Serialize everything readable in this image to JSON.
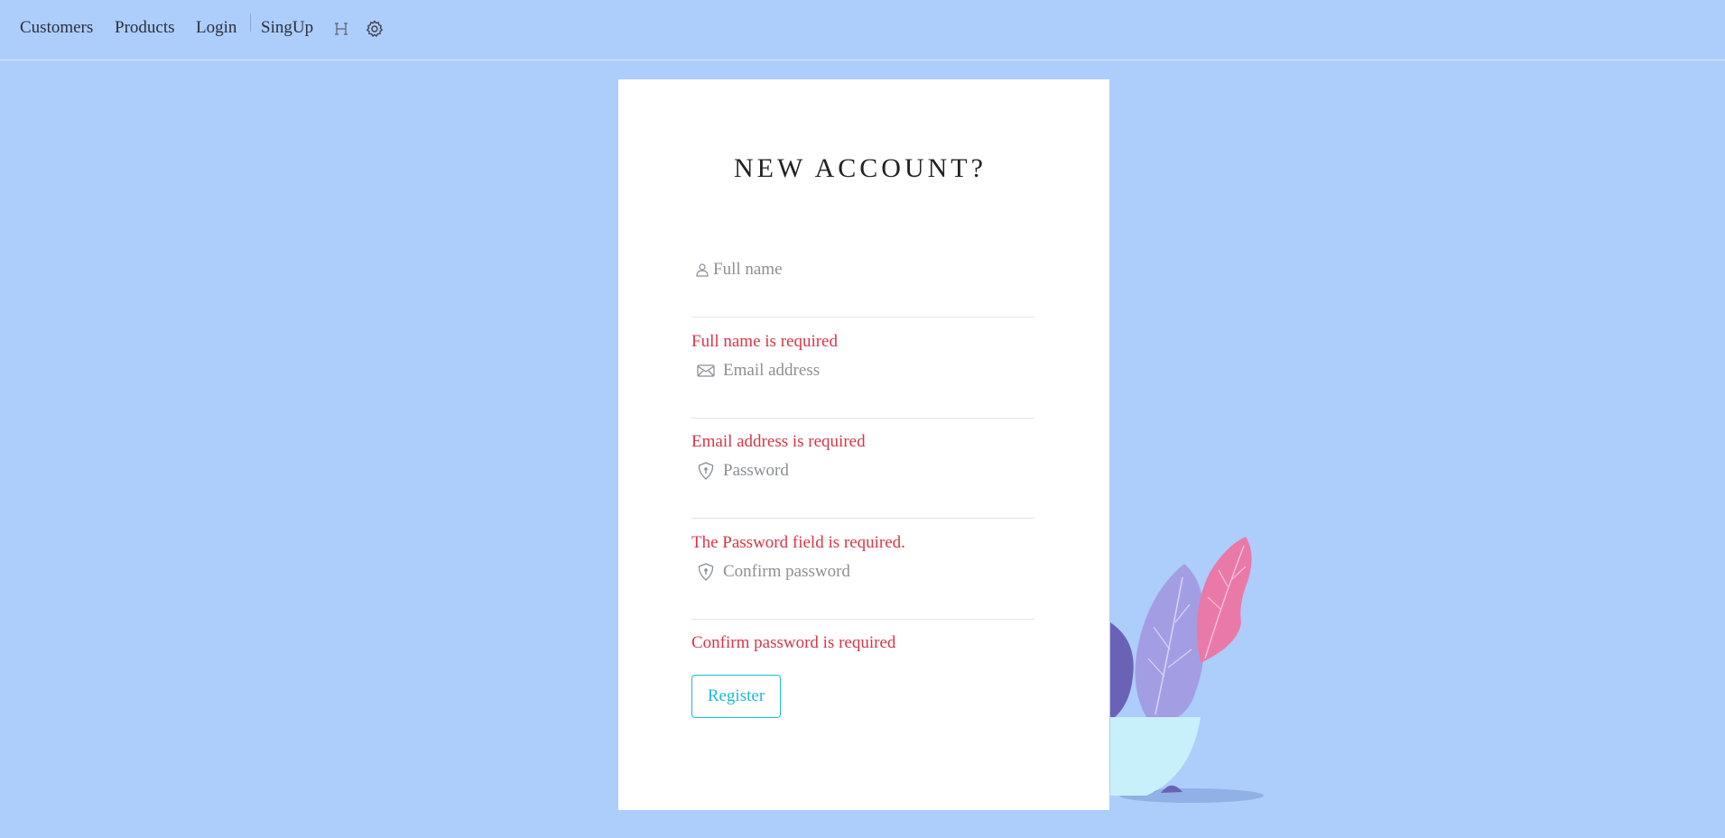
{
  "navbar": {
    "items": [
      {
        "label": "Customers"
      },
      {
        "label": "Products"
      },
      {
        "label": "Login"
      },
      {
        "label": "SingUp"
      }
    ],
    "icons": [
      "heading-icon",
      "gear-icon"
    ]
  },
  "form": {
    "title": "NEW ACCOUNT?",
    "fields": [
      {
        "placeholder": "Full name",
        "value": "",
        "icon": "user-icon",
        "error": "Full name is required"
      },
      {
        "placeholder": "Email address",
        "value": "",
        "icon": "envelope-icon",
        "error": "Email address is required"
      },
      {
        "placeholder": "Password",
        "value": "",
        "icon": "shield-lock-icon",
        "error": "The Password field is required."
      },
      {
        "placeholder": "Confirm password",
        "value": "",
        "icon": "shield-lock-icon",
        "error": "Confirm password is required"
      }
    ],
    "register_label": "Register"
  },
  "colors": {
    "background": "#adcdfb",
    "error": "#d93545",
    "accent": "#1bbbd8"
  }
}
